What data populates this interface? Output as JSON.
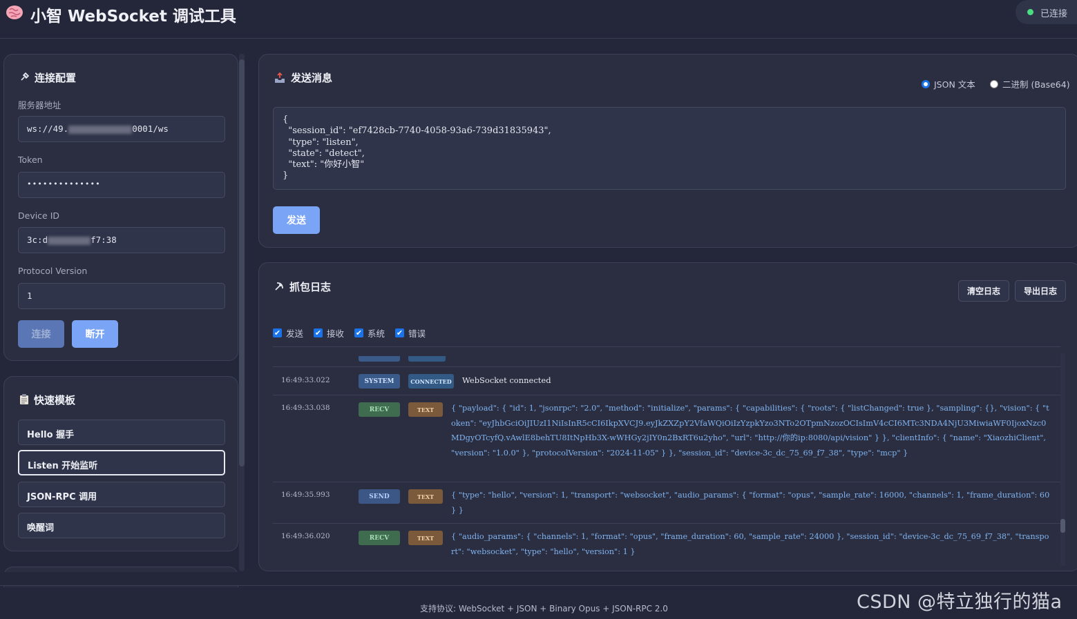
{
  "header": {
    "title": "小智 WebSocket 调试工具",
    "status": "已连接",
    "status_color": "#4ade80"
  },
  "config": {
    "title": "连接配置",
    "server_label": "服务器地址",
    "server_value_a": "ws://49.",
    "server_value_b": "0001/ws",
    "token_label": "Token",
    "token_value": "••••••••••••••",
    "device_label": "Device ID",
    "device_value_a": "3c:d",
    "device_value_b": "f7:38",
    "proto_label": "Protocol Version",
    "proto_value": "1",
    "connect": "连接",
    "disconnect": "断开"
  },
  "templates": {
    "title": "快速模板",
    "items": [
      "Hello 握手",
      "Listen 开始监听",
      "JSON-RPC 调用",
      "唤醒词"
    ]
  },
  "send": {
    "title": "发送消息",
    "mode_json": "JSON 文本",
    "mode_bin": "二进制 (Base64)",
    "message": "{\n  \"session_id\": \"ef7428cb-7740-4058-93a6-739d31835943\",\n  \"type\": \"listen\",\n  \"state\": \"detect\",\n  \"text\": \"你好小智\"\n}",
    "send_button": "发送"
  },
  "log": {
    "title": "抓包日志",
    "clear": "清空日志",
    "export": "导出日志",
    "filters": [
      "发送",
      "接收",
      "系统",
      "错误"
    ],
    "entries": [
      {
        "time": "16:49:33.022",
        "dir": "SYSTEM",
        "kind": "CONNECTED",
        "text": "WebSocket connected"
      },
      {
        "time": "16:49:33.038",
        "dir": "RECV",
        "kind": "TEXT",
        "text": "{ \"payload\": { \"id\": 1, \"jsonrpc\": \"2.0\", \"method\": \"initialize\", \"params\": { \"capabilities\": { \"roots\": { \"listChanged\": true }, \"sampling\": {}, \"vision\": { \"token\": \"eyJhbGciOiJIUzI1NiIsInR5cCI6IkpXVCJ9.eyJkZXZpY2VfaWQiOiIzYzpkYzo3NTo2OTpmNzozOCIsImV4cCI6MTc3NDA4NjU3MiwiaWF0IjoxNzc0MDgyOTcyfQ.vAwlE8behTU8ItNpHb3X-wWHGy2jIY0n2BxRT6u2yho\", \"url\": \"http://你的ip:8080/api/vision\" } }, \"clientInfo\": { \"name\": \"XiaozhiClient\", \"version\": \"1.0.0\" }, \"protocolVersion\": \"2024-11-05\" } }, \"session_id\": \"device-3c_dc_75_69_f7_38\", \"type\": \"mcp\" }"
      },
      {
        "time": "16:49:35.993",
        "dir": "SEND",
        "kind": "TEXT",
        "text": "{ \"type\": \"hello\", \"version\": 1, \"transport\": \"websocket\", \"audio_params\": { \"format\": \"opus\", \"sample_rate\": 16000, \"channels\": 1, \"frame_duration\": 60 } }"
      },
      {
        "time": "16:49:36.020",
        "dir": "RECV",
        "kind": "TEXT",
        "text": "{ \"audio_params\": { \"channels\": 1, \"format\": \"opus\", \"frame_duration\": 60, \"sample_rate\": 24000 }, \"session_id\": \"device-3c_dc_75_69_f7_38\", \"transport\": \"websocket\", \"type\": \"hello\", \"version\": 1 }"
      }
    ]
  },
  "footer": "支持协议: WebSocket + JSON + Binary Opus + JSON-RPC 2.0",
  "watermark": "CSDN @特立独行的猫a"
}
